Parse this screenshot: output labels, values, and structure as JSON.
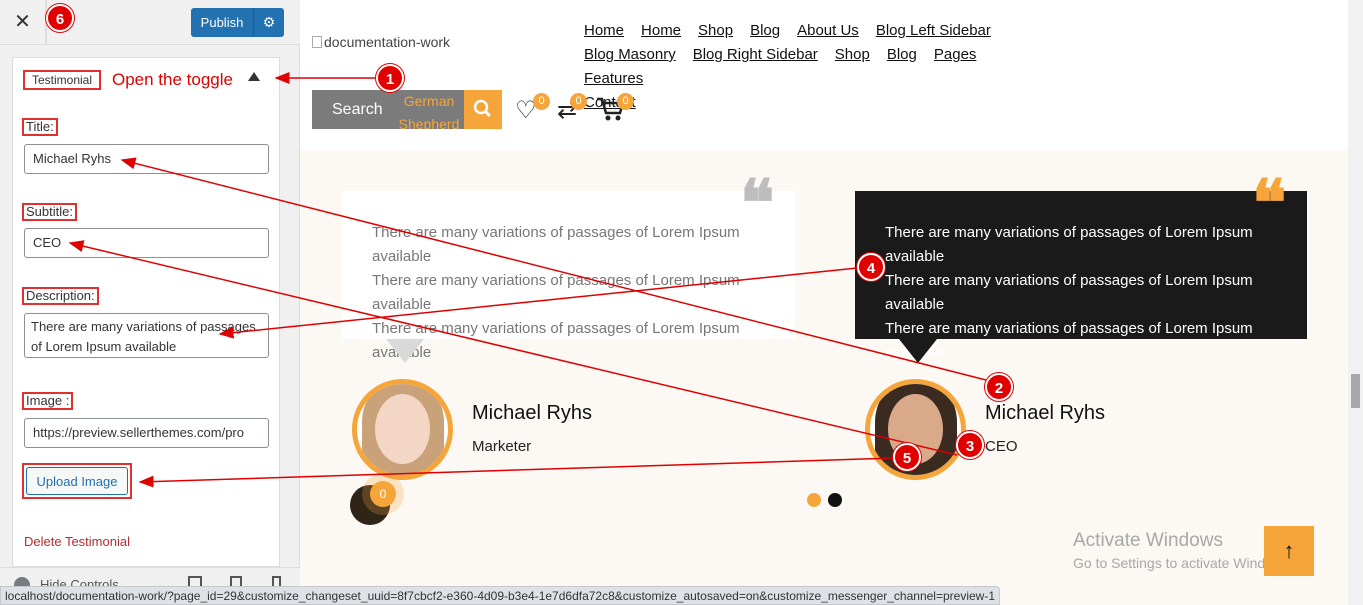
{
  "panel": {
    "close_label": "✕",
    "publish_label": "Publish",
    "gear_icon": "gear-icon",
    "section_title": "Testimonial",
    "toggle_note": "Open the toggle",
    "fields": {
      "title_label": "Title:",
      "title_value": "Michael Ryhs",
      "subtitle_label": "Subtitle:",
      "subtitle_value": "CEO",
      "description_label": "Description:",
      "description_value": "There are many variations of passages of Lorem Ipsum available",
      "image_label": "Image :",
      "image_value": "https://preview.sellerthemes.com/pro"
    },
    "upload_label": "Upload Image",
    "delete_label": "Delete Testimonial",
    "hide_controls_label": "Hide Controls"
  },
  "site": {
    "logo_alt": "documentation-work",
    "nav": [
      "Home",
      "Home",
      "Shop",
      "Blog",
      "About Us",
      "Blog Left Sidebar",
      "Blog Masonry",
      "Blog Right Sidebar",
      "Shop",
      "Blog",
      "Pages",
      "Features",
      "Contact"
    ],
    "search_label": "Search",
    "search_category": "German Shepherd",
    "wishlist_count": "0",
    "compare_count": "0",
    "cart_count": "0",
    "floating_cart_count": "0",
    "testimonials": [
      {
        "text": "There are many variations of passages of Lorem Ipsum available",
        "name": "Michael Ryhs",
        "role": "Marketer"
      },
      {
        "text": "There are many variations of passages of Lorem Ipsum available",
        "name": "Michael Ryhs",
        "role": "CEO"
      }
    ],
    "watermark_title": "Activate Windows",
    "watermark_sub": "Go to Settings to activate Windows.",
    "to_top_icon": "↑"
  },
  "annotations": {
    "badges": [
      "1",
      "2",
      "3",
      "4",
      "5",
      "6"
    ]
  },
  "statusbar_url": "localhost/documentation-work/?page_id=29&customize_changeset_uuid=8f7cbcf2-e360-4d09-b3e4-1e7d6dfa72c8&customize_autosaved=on&customize_messenger_channel=preview-1",
  "colors": {
    "accent": "#f5a53a",
    "wp_blue": "#2271b1",
    "annotation_red": "#e00000",
    "dark_card": "#1a1a1a"
  }
}
